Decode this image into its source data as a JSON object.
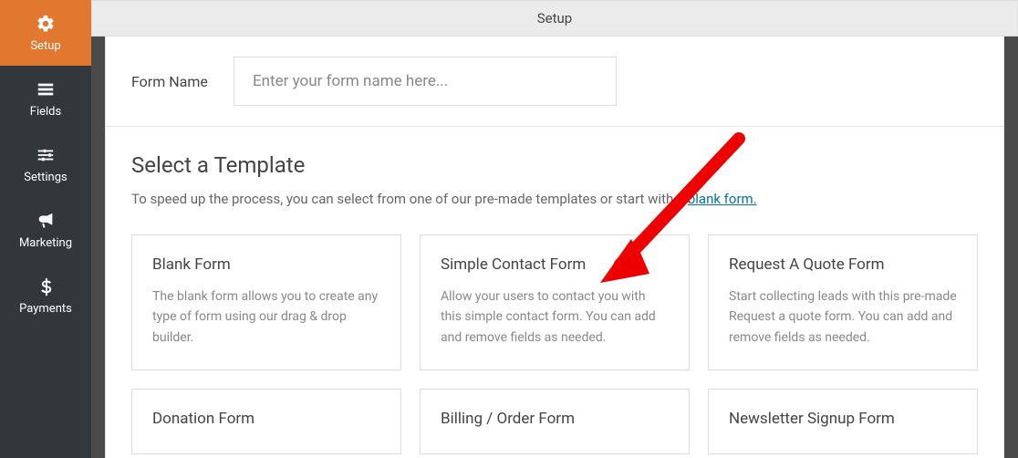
{
  "sidebar": {
    "items": [
      {
        "label": "Setup"
      },
      {
        "label": "Fields"
      },
      {
        "label": "Settings"
      },
      {
        "label": "Marketing"
      },
      {
        "label": "Payments"
      }
    ]
  },
  "topbar": {
    "title": "Setup"
  },
  "formName": {
    "label": "Form Name",
    "placeholder": "Enter your form name here..."
  },
  "templates": {
    "heading": "Select a Template",
    "desc_pre": "To speed up the process, you can select from one of our pre-made templates or start with a ",
    "desc_link": "blank form.",
    "cards": [
      {
        "title": "Blank Form",
        "desc": "The blank form allows you to create any type of form using our drag & drop builder."
      },
      {
        "title": "Simple Contact Form",
        "desc": "Allow your users to contact you with this simple contact form. You can add and remove fields as needed."
      },
      {
        "title": "Request A Quote Form",
        "desc": "Start collecting leads with this pre-made Request a quote form. You can add and remove fields as needed."
      },
      {
        "title": "Donation Form",
        "desc": ""
      },
      {
        "title": "Billing / Order Form",
        "desc": ""
      },
      {
        "title": "Newsletter Signup Form",
        "desc": ""
      }
    ]
  }
}
